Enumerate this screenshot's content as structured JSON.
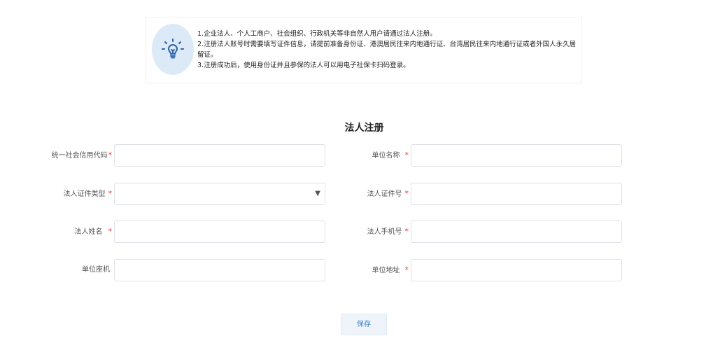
{
  "notice": {
    "icon": "lightbulb-icon",
    "lines": [
      "1.企业法人、个人工商户、社会组织、行政机关等非自然人用户请通过法人注册。",
      "2.注册法人账号时需要填写证件信息，请提前准备身份证、港澳居民往来内地通行证、台湾居民往来内地通行证或者外国人永久居留证。",
      "3.注册成功后，使用身份证并且参保的法人可以用电子社保卡扫码登录。"
    ]
  },
  "form": {
    "title": "法人注册",
    "fields": {
      "credit_code": {
        "label": "统一社会信用代码",
        "required": "*",
        "value": ""
      },
      "unit_name": {
        "label": "单位名称",
        "required": "*",
        "value": ""
      },
      "cert_type": {
        "label": "法人证件类型",
        "required": "*",
        "value": ""
      },
      "cert_number": {
        "label": "法人证件号",
        "required": "*",
        "value": ""
      },
      "legal_name": {
        "label": "法人姓名",
        "required": "*",
        "value": ""
      },
      "legal_phone": {
        "label": "法人手机号",
        "required": "*",
        "value": ""
      },
      "unit_landline": {
        "label": "单位座机",
        "value": ""
      },
      "unit_address": {
        "label": "单位地址",
        "required": "*",
        "value": ""
      }
    },
    "save_label": "保存"
  },
  "colors": {
    "required": "#e23b3b",
    "accent": "#3b7dc4",
    "bulb_bg": "#dce9f6"
  }
}
